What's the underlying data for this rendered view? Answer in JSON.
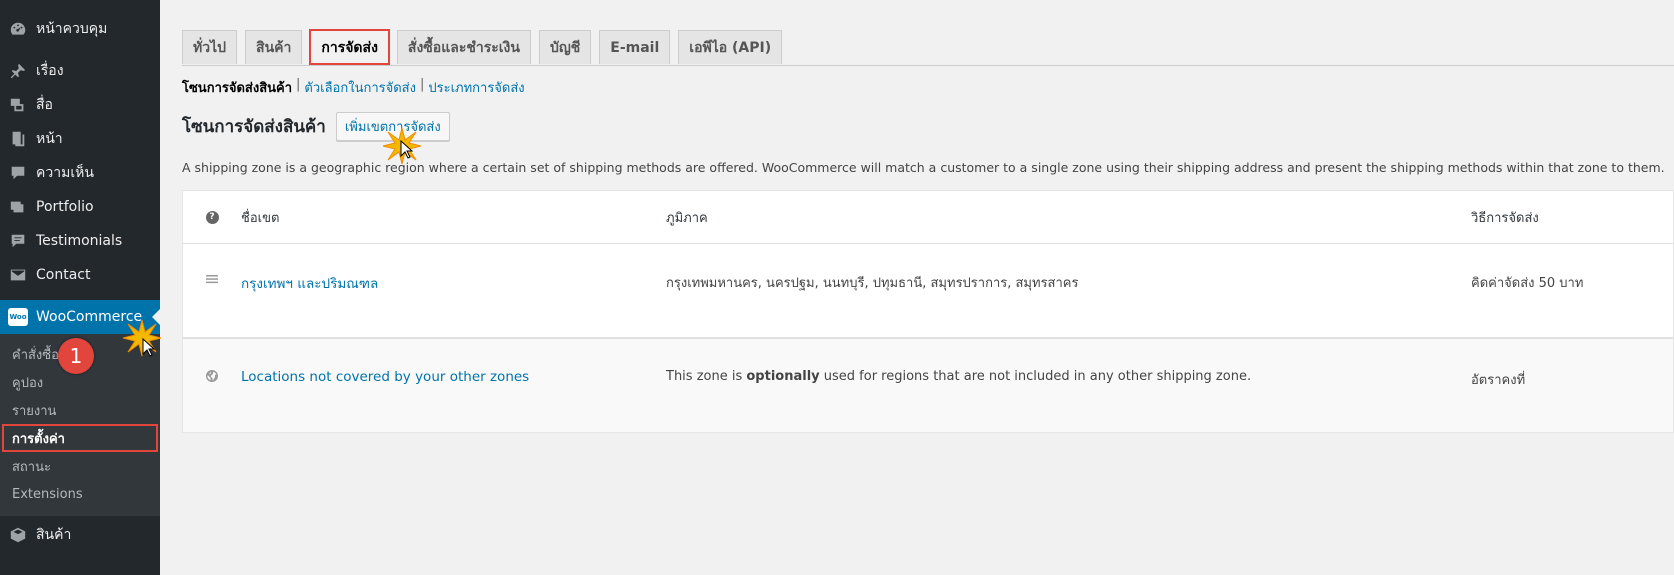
{
  "sidebar": {
    "items": [
      {
        "label": "หน้าควบคุม",
        "icon": "dashboard-icon"
      },
      {
        "label": "เรื่อง",
        "icon": "pin-icon"
      },
      {
        "label": "สื่อ",
        "icon": "media-icon"
      },
      {
        "label": "หน้า",
        "icon": "page-icon"
      },
      {
        "label": "ความเห็น",
        "icon": "comment-icon"
      },
      {
        "label": "Portfolio",
        "icon": "portfolio-icon"
      },
      {
        "label": "Testimonials",
        "icon": "testimonial-icon"
      },
      {
        "label": "Contact",
        "icon": "mail-icon"
      }
    ],
    "woocommerce": {
      "label": "WooCommerce",
      "icon_text": "Woo"
    },
    "submenu": [
      "คำสั่งซื้อ",
      "คูปอง",
      "รายงาน",
      "การตั้งค่า",
      "สถานะ",
      "Extensions"
    ],
    "products": {
      "label": "สินค้า"
    }
  },
  "tabs": [
    "ทั่วไป",
    "สินค้า",
    "การจัดส่ง",
    "สั่งซื้อและชำระเงิน",
    "บัญชี",
    "E-mail",
    "เอพีไอ (API)"
  ],
  "subsub": {
    "current": "โซนการจัดส่งสินค้า",
    "sep": "|",
    "link1": "ตัวเลือกในการจัดส่ง",
    "link2": "ประเภทการจัดส่ง"
  },
  "heading": {
    "title": "โซนการจัดส่งสินค้า",
    "add_button": "เพิ่มเขตการจัดส่ง"
  },
  "description": "A shipping zone is a geographic region where a certain set of shipping methods are offered. WooCommerce will match a customer to a single zone using their shipping address and present the shipping methods within that zone to them.",
  "table": {
    "headers": {
      "help": "?",
      "name": "ชื่อเขต",
      "region": "ภูมิภาค",
      "methods": "วิธีการจัดส่ง"
    },
    "rows": [
      {
        "name": "กรุงเทพฯ และปริมณฑล",
        "region": "กรุงเทพมหานคร, นครปฐม, นนทบุรี, ปทุมธานี, สมุทรปราการ, สมุทรสาคร",
        "methods": "คิดค่าจัดส่ง 50 บาท"
      },
      {
        "name": "Locations not covered by your other zones",
        "region_pre": "This zone is ",
        "region_bold": "optionally",
        "region_post": " used for regions that are not included in any other shipping zone.",
        "methods": "อัตราคงที่"
      }
    ]
  },
  "annotation": {
    "step": "1"
  },
  "colors": {
    "sidebar": "#23282d",
    "accent": "#0073aa",
    "highlight": "#e2453c"
  }
}
